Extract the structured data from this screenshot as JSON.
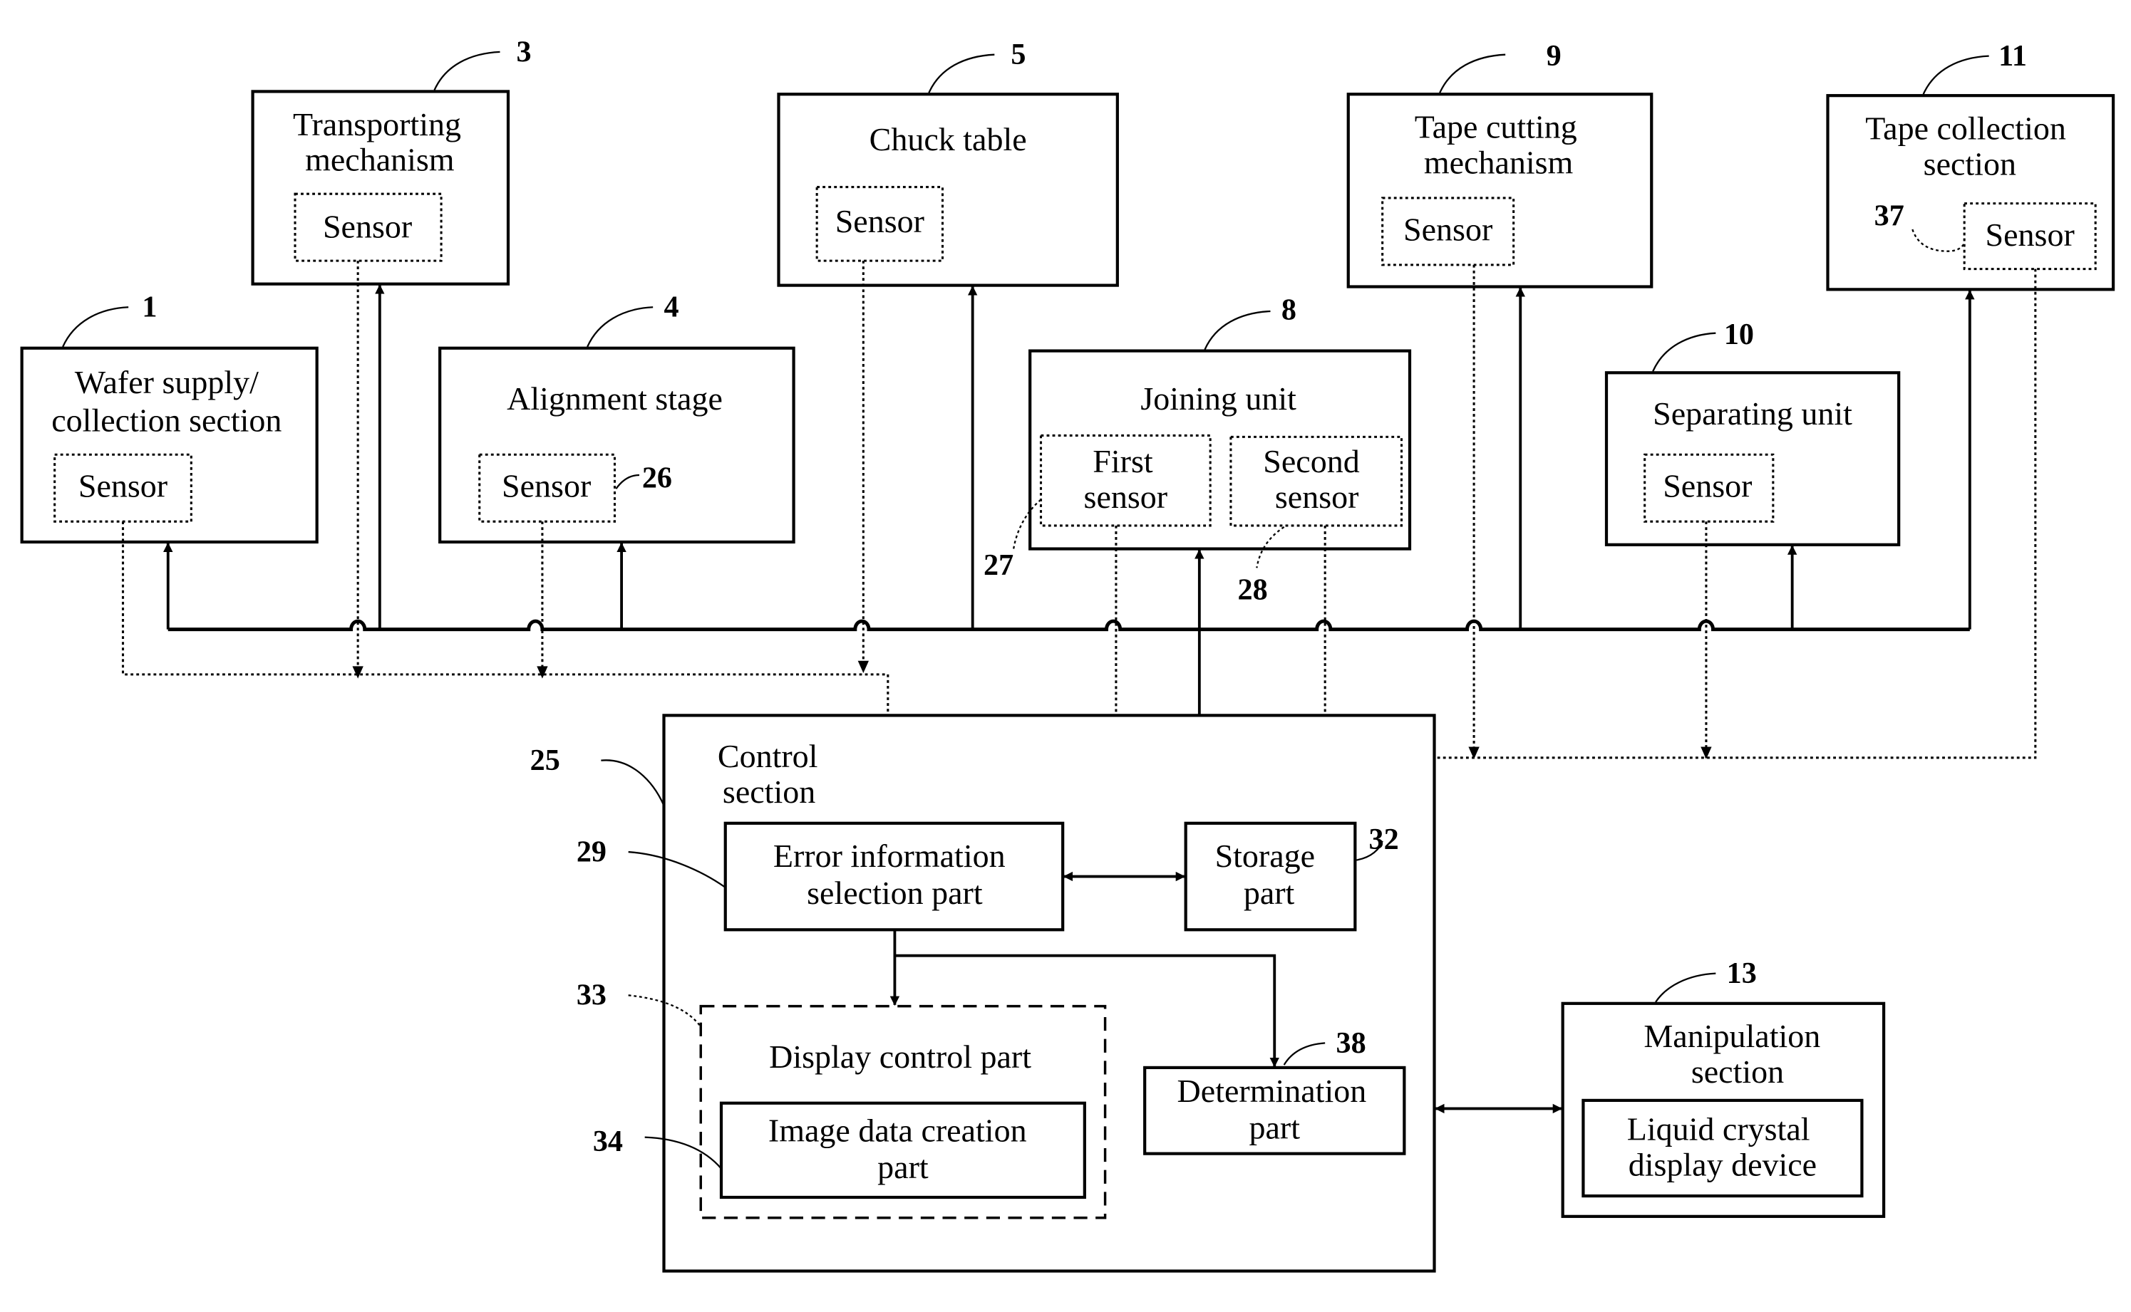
{
  "figure": {
    "blocks": {
      "wafer_supply": {
        "ref": "1",
        "line1": "Wafer supply/",
        "line2": "collection section",
        "sensor": "Sensor"
      },
      "transporting": {
        "ref": "3",
        "line1": "Transporting",
        "line2": "mechanism",
        "sensor": "Sensor"
      },
      "alignment": {
        "ref": "4",
        "title": "Alignment stage",
        "sensor": "Sensor",
        "sensor_ref": "26"
      },
      "chuck_table": {
        "ref": "5",
        "title": "Chuck table",
        "sensor": "Sensor"
      },
      "joining_unit": {
        "ref": "8",
        "title": "Joining unit",
        "first_sensor_1": "First",
        "first_sensor_2": "sensor",
        "first_sensor_ref": "27",
        "second_sensor_1": "Second",
        "second_sensor_2": "sensor",
        "second_sensor_ref": "28"
      },
      "tape_cutting": {
        "ref": "9",
        "line1": "Tape cutting",
        "line2": "mechanism",
        "sensor": "Sensor"
      },
      "separating": {
        "ref": "10",
        "title": "Separating unit",
        "sensor": "Sensor"
      },
      "tape_collection": {
        "ref": "11",
        "line1": "Tape collection",
        "line2": "section",
        "sensor": "Sensor",
        "sensor_ref": "37"
      },
      "control": {
        "ref": "25",
        "line1": "Control",
        "line2": "section"
      },
      "error_selection": {
        "ref": "29",
        "line1": "Error information",
        "line2": "selection part"
      },
      "storage": {
        "ref": "32",
        "line1": "Storage",
        "line2": "part"
      },
      "display_control": {
        "ref": "33",
        "title": "Display control part"
      },
      "image_data": {
        "ref": "34",
        "line1": "Image data creation",
        "line2": "part"
      },
      "determination": {
        "ref": "38",
        "line1": "Determination",
        "line2": "part"
      },
      "manipulation": {
        "ref": "13",
        "line1": "Manipulation",
        "line2": "section",
        "lcd_1": "Liquid crystal",
        "lcd_2": "display device"
      }
    }
  }
}
